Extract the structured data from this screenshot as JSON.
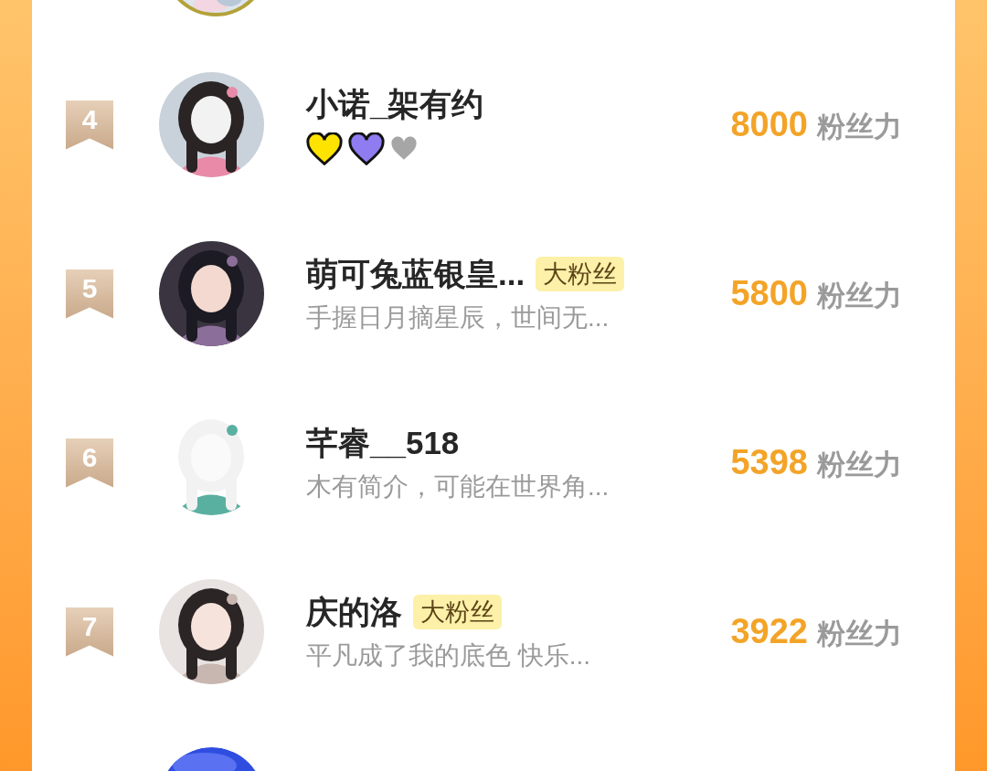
{
  "ranking": [
    {
      "rank": "4",
      "name": "小诺_架有约",
      "hearts": [
        {
          "color": "#ffe300",
          "filled": true
        },
        {
          "color": "#8e7cf0",
          "filled": true
        },
        {
          "color": "#a6a6a6",
          "filled": false
        }
      ],
      "score": "8000",
      "score_unit": "粉丝力"
    },
    {
      "rank": "5",
      "name": "萌可兔蓝银皇...",
      "badge": "大粉丝",
      "bio": "手握日月摘星辰，世间无...",
      "score": "5800",
      "score_unit": "粉丝力"
    },
    {
      "rank": "6",
      "name": "芊睿__518",
      "bio": "木有简介，可能在世界角...",
      "score": "5398",
      "score_unit": "粉丝力"
    },
    {
      "rank": "7",
      "name": "庆的洛",
      "badge": "大粉丝",
      "bio": "平凡成了我的底色 快乐...",
      "score": "3922",
      "score_unit": "粉丝力"
    }
  ]
}
